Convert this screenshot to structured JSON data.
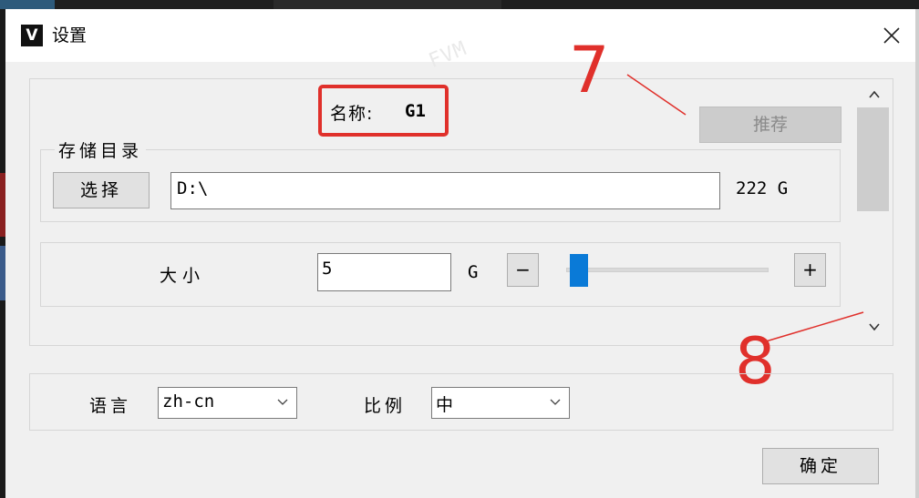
{
  "window": {
    "icon_letter": "V",
    "title": "设置",
    "watermark": "FVM"
  },
  "header": {
    "name_label": "名称:",
    "name_value": "G1",
    "recommend_button": "推荐"
  },
  "storage": {
    "legend": "存储目录",
    "choose_button": "选择",
    "path_value": "D:\\",
    "free_space": "222 G"
  },
  "size": {
    "label": "大小",
    "value": "5",
    "unit": "G",
    "minus": "−",
    "plus": "+",
    "slider_fraction": 0.02
  },
  "settings": {
    "language_label": "语言",
    "language_value": "zh-cn",
    "ratio_label": "比例",
    "ratio_value": "中"
  },
  "footer": {
    "ok_button": "确定"
  },
  "annotations": {
    "label_7": "7",
    "label_8": "8",
    "color": "#e0302b"
  },
  "colors": {
    "accent": "#0a7ad7",
    "highlight": "#e0302b"
  }
}
